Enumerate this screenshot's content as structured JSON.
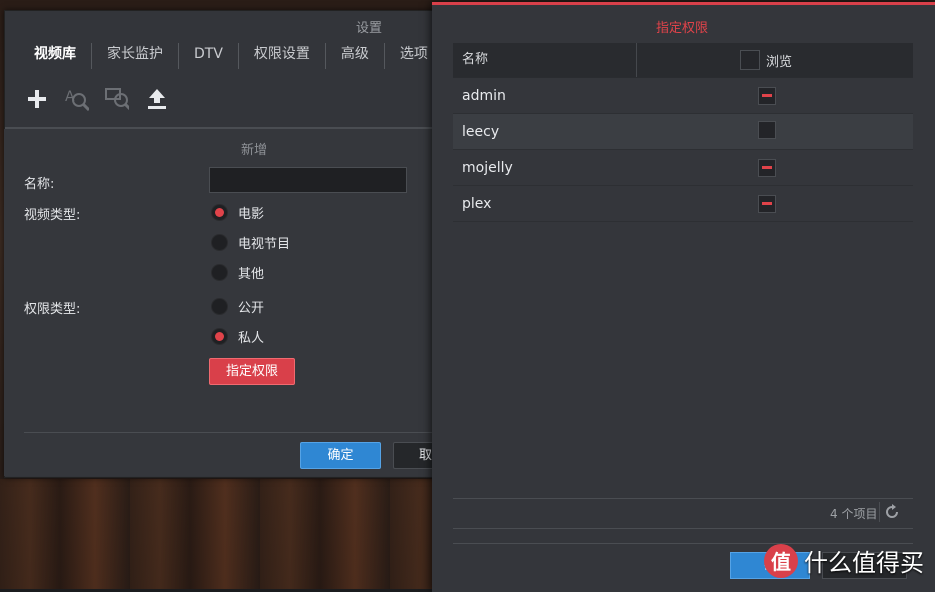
{
  "settings": {
    "title": "设置",
    "tabs": [
      "视频库",
      "家长监护",
      "DTV",
      "权限设置",
      "高级",
      "选项"
    ],
    "toolbar": {
      "add_icon": "plus-icon",
      "search_meta_icon": "search-text-icon",
      "search_scan_icon": "search-scan-icon",
      "upload_icon": "upload-icon"
    }
  },
  "add_dialog": {
    "title": "新增",
    "name_label": "名称:",
    "name_value": "",
    "video_type_label": "视频类型:",
    "video_types": [
      {
        "label": "电影",
        "selected": true
      },
      {
        "label": "电视节目",
        "selected": false
      },
      {
        "label": "其他",
        "selected": false
      }
    ],
    "permission_type_label": "权限类型:",
    "permission_types": [
      {
        "label": "公开",
        "selected": false
      },
      {
        "label": "私人",
        "selected": true
      }
    ],
    "assign_permission_button": "指定权限",
    "ok_button": "确定",
    "cancel_button": "取"
  },
  "permissions": {
    "title": "指定权限",
    "columns": {
      "name": "名称",
      "browse": "浏览"
    },
    "rows": [
      {
        "name": "admin",
        "browse": "partial"
      },
      {
        "name": "leecy",
        "browse": "unchecked"
      },
      {
        "name": "mojelly",
        "browse": "partial"
      },
      {
        "name": "plex",
        "browse": "partial"
      }
    ],
    "item_count": "4 个项目",
    "ok_button": "确",
    "cancel_button": ""
  },
  "watermark": {
    "logo": "值",
    "text": "什么值得买"
  },
  "colors": {
    "accent_red": "#d9404a",
    "primary_blue": "#2f87d3"
  }
}
